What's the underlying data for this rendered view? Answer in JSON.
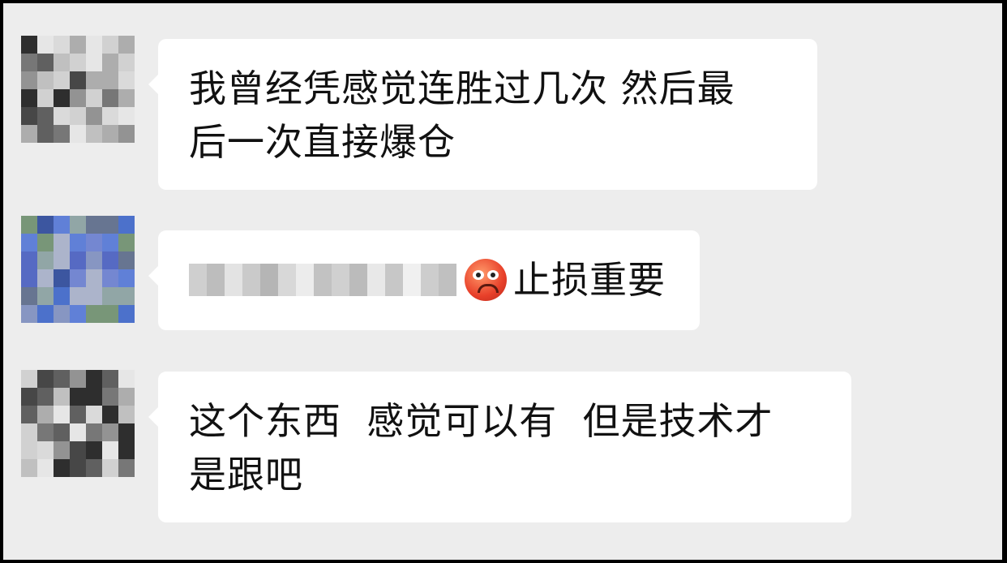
{
  "chat": {
    "messages": [
      {
        "avatar": "pixelated-avatar-gray",
        "text": "我曾经凭感觉连胜过几次 然后最\n后一次直接爆仓"
      },
      {
        "avatar": "pixelated-avatar-blue",
        "emoji": "angry-face-emoji",
        "text": "止损重要"
      },
      {
        "avatar": "pixelated-avatar-gray",
        "text": "这个东西  感觉可以有  但是技术才\n是跟吧"
      }
    ]
  },
  "colors": {
    "background": "#ededed",
    "bubble": "#ffffff",
    "frame": "#000000"
  }
}
